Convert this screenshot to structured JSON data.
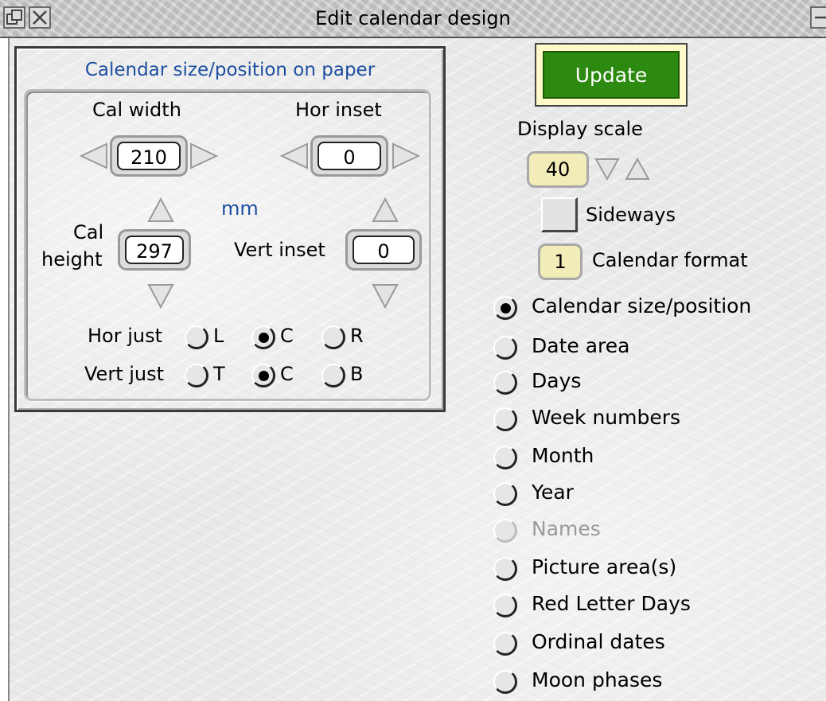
{
  "window": {
    "title": "Edit calendar design"
  },
  "size_panel": {
    "title": "Calendar size/position on paper",
    "cal_width_label": "Cal width",
    "cal_width_value": "210",
    "hor_inset_label": "Hor inset",
    "hor_inset_value": "0",
    "unit_label": "mm",
    "cal_height_label_line1": "Cal",
    "cal_height_label_line2": "height",
    "cal_height_value": "297",
    "vert_inset_label": "Vert inset",
    "vert_inset_value": "0",
    "hor_just": {
      "label": "Hor just",
      "options": [
        "L",
        "C",
        "R"
      ],
      "selected": "C"
    },
    "vert_just": {
      "label": "Vert just",
      "options": [
        "T",
        "C",
        "B"
      ],
      "selected": "C"
    }
  },
  "controls": {
    "update_label": "Update",
    "display_scale_label": "Display scale",
    "display_scale_value": "40",
    "sideways_label": "Sideways",
    "sideways_checked": false,
    "calendar_format_value": "1",
    "calendar_format_label": "Calendar format"
  },
  "sections": {
    "selected": "Calendar size/position",
    "items": [
      {
        "label": "Calendar size/position",
        "enabled": true
      },
      {
        "label": "Date area",
        "enabled": true
      },
      {
        "label": "Days",
        "enabled": true
      },
      {
        "label": "Week numbers",
        "enabled": true
      },
      {
        "label": "Month",
        "enabled": true
      },
      {
        "label": "Year",
        "enabled": true
      },
      {
        "label": "Names",
        "enabled": false
      },
      {
        "label": "Picture area(s)",
        "enabled": true
      },
      {
        "label": "Red Letter Days",
        "enabled": true
      },
      {
        "label": "Ordinal dates",
        "enabled": true
      },
      {
        "label": "Moon phases",
        "enabled": true
      }
    ]
  },
  "colors": {
    "panel_title": "#1e4fa0",
    "update_button": "#2c8a11",
    "writable_highlight": "#f2edb8"
  }
}
